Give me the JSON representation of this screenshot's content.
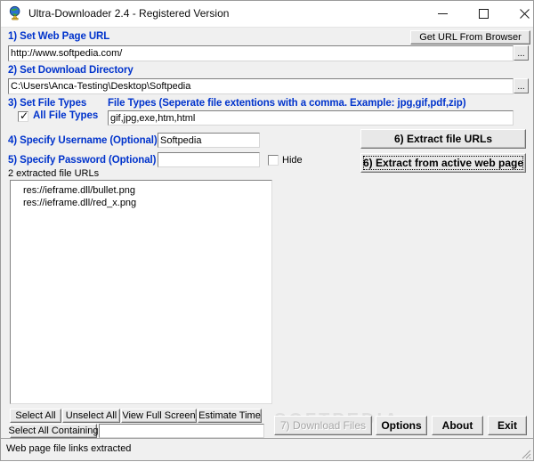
{
  "window": {
    "title": "Ultra-Downloader 2.4 - Registered Version",
    "icon": "globe-icon",
    "minimize_label": "minimize-icon",
    "maximize_label": "maximize-icon",
    "close_label": "close-icon"
  },
  "step1": {
    "label": "1) Set Web Page URL",
    "get_url_button": "Get URL From Browser",
    "url_value": "http://www.softpedia.com/",
    "browse_button": "..."
  },
  "step2": {
    "label": "2) Set Download Directory",
    "dir_value": "C:\\Users\\Anca-Testing\\Desktop\\Softpedia",
    "browse_button": "..."
  },
  "step3": {
    "label": "3) Set File Types",
    "all_file_types_label": "All File Types",
    "all_file_types_checked": true,
    "file_types_hint": "File Types (Seperate file extentions with a comma. Example: jpg,gif,pdf,zip)",
    "file_types_value": "gif,jpg,exe,htm,html"
  },
  "step4": {
    "label": "4) Specify Username (Optional)",
    "username_value": "Softpedia"
  },
  "step5": {
    "label": "5) Specify Password (Optional)",
    "password_value": "",
    "hide_label": "Hide",
    "hide_checked": false
  },
  "step6": {
    "extract_file_urls": "6) Extract file URLs",
    "extract_active_page": "6) Extract from active web page"
  },
  "results": {
    "count_label": "2 extracted file URLs",
    "items": [
      "res://ieframe.dll/bullet.png",
      "res://ieframe.dll/red_x.png"
    ]
  },
  "selection_toolbar": {
    "select_all": "Select All",
    "unselect_all": "Unselect All",
    "view_full_screen": "View Full Screen",
    "estimate_time": "Estimate Time",
    "select_all_containing": "Select All Containing",
    "containing_value": ""
  },
  "actions": {
    "download_files": "7) Download Files",
    "download_files_disabled": true,
    "options": "Options",
    "about": "About",
    "exit": "Exit"
  },
  "statusbar": {
    "message": "Web page file links extracted"
  },
  "watermark": {
    "text": "SOFTPEDIA"
  },
  "colors": {
    "step_label_blue": "#0033cc",
    "window_background": "#f0f0f0",
    "field_background": "#ffffff",
    "button_face": "#e8e8e8",
    "disabled_text": "#a8a8a8"
  }
}
